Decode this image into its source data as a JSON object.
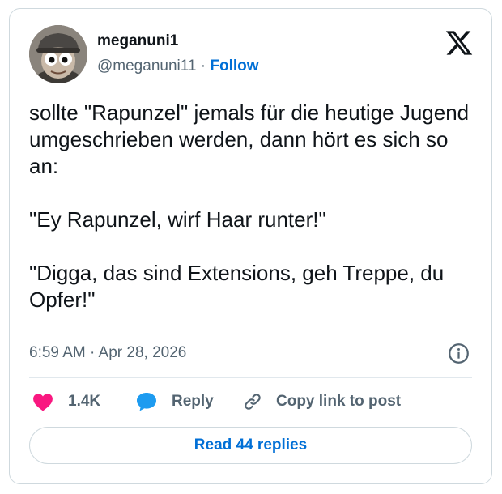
{
  "author": {
    "name": "meganuni1",
    "handle": "@meganuni11",
    "separator": " · ",
    "follow_label": "Follow"
  },
  "tweet": {
    "text": "sollte \"Rapunzel\" jemals für die heutige Jugend umgeschrieben werden, dann hört es sich so an:\n\n \"Ey Rapunzel, wirf Haar runter!\"\n\n \"Digga, das sind Extensions, geh Treppe, du Opfer!\"",
    "timestamp": "6:59 AM · Apr 28, 2026"
  },
  "actions": {
    "likes": "1.4K",
    "reply_label": "Reply",
    "copy_label": "Copy link to post"
  },
  "replies_button": "Read 44 replies",
  "icons": {
    "brand": "x-logo-icon",
    "like": "heart-icon",
    "reply": "speech-bubble-icon",
    "copy": "link-icon",
    "info": "info-icon"
  },
  "colors": {
    "like": "#f91880",
    "reply": "#1d9bf0",
    "link": "#006fd6",
    "muted": "#536471",
    "text": "#0f1419"
  }
}
